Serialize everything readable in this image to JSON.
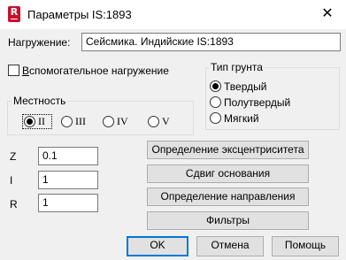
{
  "title": "Параметры IS:1893",
  "load": {
    "label": "Нагружение:",
    "value": "Сейсмика. Индийские IS:1893"
  },
  "auxiliary_load": {
    "label": "Вспомогательное нагружение",
    "checked": false
  },
  "terrain": {
    "legend": "Местность",
    "options": [
      "II",
      "III",
      "IV",
      "V"
    ],
    "selected": "II"
  },
  "soil_type": {
    "legend": "Тип грунта",
    "options": [
      "Твердый",
      "Полутвердый",
      "Мягкий"
    ],
    "selected": "Твердый"
  },
  "params": [
    {
      "label": "Z",
      "value": "0.1"
    },
    {
      "label": "I",
      "value": "1"
    },
    {
      "label": "R",
      "value": "1"
    }
  ],
  "action_buttons": {
    "eccentricity": "Определение эксцентриситета",
    "base_shift": "Сдвиг основания",
    "direction": "Определение направления",
    "filters": "Фильтры"
  },
  "footer": {
    "ok": "OK",
    "cancel": "Отмена",
    "help": "Помощь"
  },
  "close_glyph": "✕"
}
